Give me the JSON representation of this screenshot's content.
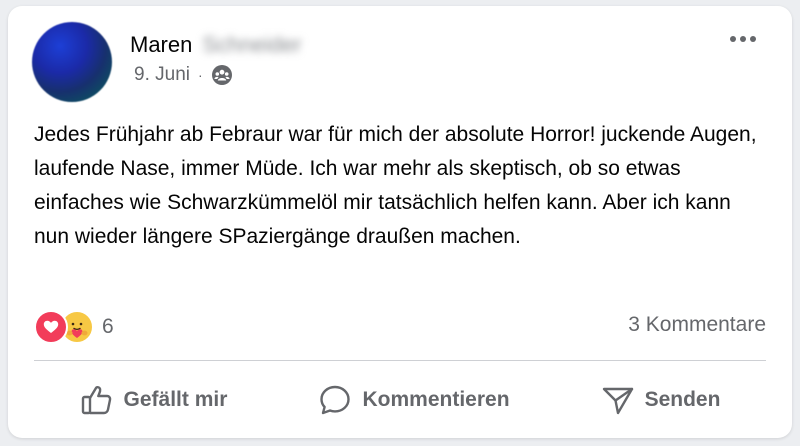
{
  "post": {
    "author_first_name": "Maren",
    "author_last_name_blurred": "Schneider",
    "date": "9. Juni",
    "separator": "·",
    "audience_icon": "friends-icon",
    "text": "Jedes Frühjahr ab Febraur war für mich der absolute Horror! juckende Augen, laufende Nase, immer Müde. Ich war mehr als skeptisch, ob so etwas einfaches wie Schwarzkümmelöl mir tatsächlich helfen kann. Aber ich kann nun wieder längere SPaziergänge draußen machen.",
    "reactions": {
      "icons": [
        "love-reaction-icon",
        "care-reaction-icon"
      ],
      "count": "6"
    },
    "comments_label": "3 Kommentare"
  },
  "actions": {
    "like_label": "Gefällt mir",
    "comment_label": "Kommentieren",
    "send_label": "Senden"
  },
  "colors": {
    "text_primary": "#050505",
    "text_secondary": "#65676b",
    "love": "#f23c5a",
    "care": "#f7c844"
  }
}
